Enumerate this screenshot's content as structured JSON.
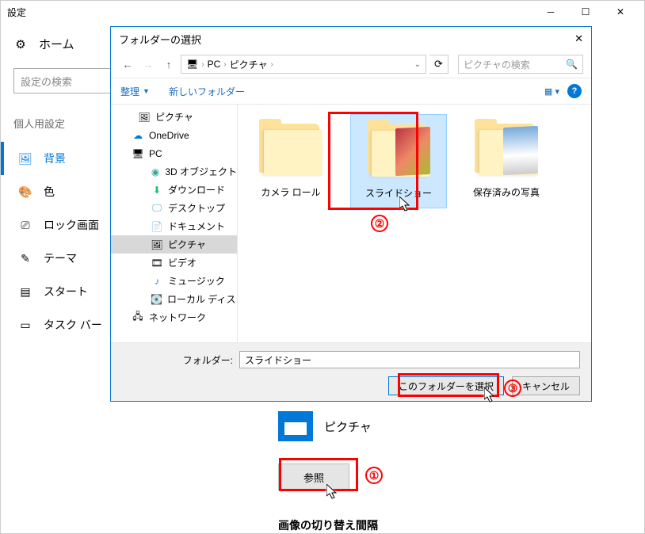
{
  "settings": {
    "title": "設定",
    "home": "ホーム",
    "search_placeholder": "設定の検索",
    "section": "個人用設定",
    "nav": {
      "background": "背景",
      "color": "色",
      "lock": "ロック画面",
      "theme": "テーマ",
      "start": "スタート",
      "taskbar": "タスク バー"
    }
  },
  "main": {
    "picture_label": "ピクチャ",
    "browse": "参照",
    "interval": "画像の切り替え間隔"
  },
  "dialog": {
    "title": "フォルダーの選択",
    "breadcrumb": {
      "a": "PC",
      "b": "ピクチャ"
    },
    "search_placeholder": "ピクチャの検索",
    "toolbar": {
      "organize": "整理",
      "newfolder": "新しいフォルダー"
    },
    "tree": {
      "pictures": "ピクチャ",
      "onedrive": "OneDrive",
      "pc": "PC",
      "objects3d": "3D オブジェクト",
      "downloads": "ダウンロード",
      "desktop": "デスクトップ",
      "documents": "ドキュメント",
      "pictures2": "ピクチャ",
      "videos": "ビデオ",
      "music": "ミュージック",
      "localdisk": "ローカル ディスク (C",
      "network": "ネットワーク"
    },
    "items": {
      "cameraroll": "カメラ ロール",
      "slideshow": "スライドショー",
      "saved": "保存済みの写真"
    },
    "footer": {
      "label": "フォルダー:",
      "value": "スライドショー",
      "select": "このフォルダーを選択",
      "cancel": "キャンセル"
    }
  },
  "annotations": {
    "n1": "①",
    "n2": "②",
    "n3": "③"
  }
}
